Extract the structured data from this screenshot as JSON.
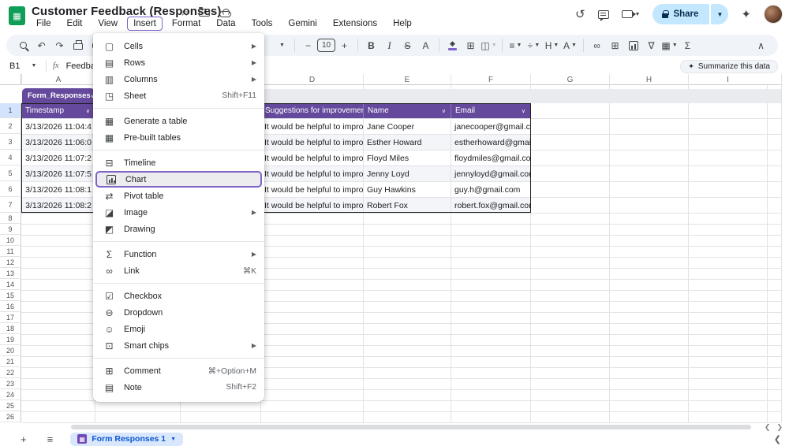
{
  "titlebar": {
    "title": "Customer Feedback (Responses)",
    "icons": [
      "star-icon",
      "move-folder-icon",
      "cloud-status-icon"
    ],
    "right_icons": [
      "history-icon",
      "comments-icon",
      "video-call-icon",
      "gemini-sparkle-icon"
    ],
    "share_label": "Share"
  },
  "menubar": {
    "items": [
      {
        "label": "File"
      },
      {
        "label": "Edit"
      },
      {
        "label": "View"
      },
      {
        "label": "Insert",
        "active": true
      },
      {
        "label": "Format"
      },
      {
        "label": "Data"
      },
      {
        "label": "Tools"
      },
      {
        "label": "Gemini"
      },
      {
        "label": "Extensions"
      },
      {
        "label": "Help"
      }
    ]
  },
  "toolbar": {
    "font_size": "10"
  },
  "formula_bar": {
    "cell_ref": "B1",
    "fx_label": "fx",
    "value": "Feedba"
  },
  "summarize": {
    "label": "Summarize this data",
    "icon_glyph": "✦"
  },
  "insert_menu": {
    "items": [
      {
        "type": "item",
        "icon": "cells-icon",
        "glyph": "▢",
        "label": "Cells",
        "submenu": true
      },
      {
        "type": "item",
        "icon": "rows-icon",
        "glyph": "▤",
        "label": "Rows",
        "submenu": true
      },
      {
        "type": "item",
        "icon": "columns-icon",
        "glyph": "▥",
        "label": "Columns",
        "submenu": true
      },
      {
        "type": "item",
        "icon": "sheet-icon",
        "glyph": "◳",
        "label": "Sheet",
        "shortcut": "Shift+F11"
      },
      {
        "type": "divider"
      },
      {
        "type": "item",
        "icon": "generate-table-icon",
        "glyph": "▦",
        "label": "Generate a table"
      },
      {
        "type": "item",
        "icon": "pre-built-tables-icon",
        "glyph": "▦",
        "label": "Pre-built tables"
      },
      {
        "type": "divider"
      },
      {
        "type": "item",
        "icon": "timeline-icon",
        "glyph": "⊟",
        "label": "Timeline"
      },
      {
        "type": "item",
        "icon": "chart-icon",
        "glyph": "",
        "css_icon": true,
        "label": "Chart",
        "highlighted": true
      },
      {
        "type": "item",
        "icon": "pivot-table-icon",
        "glyph": "⇄",
        "label": "Pivot table"
      },
      {
        "type": "item",
        "icon": "image-icon",
        "glyph": "◪",
        "label": "Image",
        "submenu": true
      },
      {
        "type": "item",
        "icon": "drawing-icon",
        "glyph": "◩",
        "label": "Drawing"
      },
      {
        "type": "divider"
      },
      {
        "type": "item",
        "icon": "function-icon",
        "glyph": "Σ",
        "label": "Function",
        "submenu": true
      },
      {
        "type": "item",
        "icon": "link-icon",
        "glyph": "∞",
        "label": "Link",
        "shortcut": "⌘K"
      },
      {
        "type": "divider"
      },
      {
        "type": "item",
        "icon": "checkbox-icon",
        "glyph": "☑",
        "label": "Checkbox"
      },
      {
        "type": "item",
        "icon": "dropdown-icon",
        "glyph": "⊖",
        "label": "Dropdown"
      },
      {
        "type": "item",
        "icon": "emoji-icon",
        "glyph": "☺",
        "label": "Emoji"
      },
      {
        "type": "item",
        "icon": "smart-chips-icon",
        "glyph": "⊡",
        "label": "Smart chips",
        "submenu": true
      },
      {
        "type": "divider"
      },
      {
        "type": "item",
        "icon": "comment-icon",
        "glyph": "⊞",
        "label": "Comment",
        "shortcut": "⌘+Option+M"
      },
      {
        "type": "item",
        "icon": "note-icon",
        "glyph": "▤",
        "label": "Note",
        "shortcut": "Shift+F2"
      }
    ]
  },
  "grid": {
    "column_letters": [
      "A",
      "B",
      "C",
      "D",
      "E",
      "F",
      "G",
      "H",
      "I"
    ],
    "row_numbers": [
      1,
      2,
      3,
      4,
      5,
      6,
      7,
      8,
      9,
      10,
      11,
      12,
      13,
      14,
      15,
      16,
      17,
      18,
      19,
      20,
      21,
      22,
      23,
      24,
      25,
      26
    ],
    "selected_row": 1
  },
  "table": {
    "name": "Form_Responses",
    "headers": [
      {
        "col": "A",
        "label": "Timestamp"
      },
      {
        "col": "D",
        "label": "Suggestions for improvement"
      },
      {
        "col": "E",
        "label": "Name"
      },
      {
        "col": "F",
        "label": "Email"
      }
    ],
    "rows": [
      {
        "timestamp": "3/13/2026 11:04:4",
        "suggestion": "It would be helpful to improve page",
        "name": "Jane Cooper",
        "email": "janecooper@gmail.com"
      },
      {
        "timestamp": "3/13/2026 11:06:0",
        "suggestion": "It would be helpful to improve page",
        "name": "Esther Howard",
        "email": "estherhoward@gmail.co"
      },
      {
        "timestamp": "3/13/2026 11:07:2",
        "suggestion": "It would be helpful to improve page",
        "name": "Floyd Miles",
        "email": "floydmiles@gmail.com"
      },
      {
        "timestamp": "3/13/2026 11:07:5",
        "suggestion": "It would be helpful to improve page",
        "name": "Jenny Loyd",
        "email": "jennyloyd@gmail.com"
      },
      {
        "timestamp": "3/13/2026 11:08:1",
        "suggestion": "It would be helpful to improve page",
        "name": "Guy Hawkins",
        "email": "guy.h@gmail.com"
      },
      {
        "timestamp": "3/13/2026 11:08:2",
        "suggestion": "It would be helpful to improve page",
        "name": "Robert Fox",
        "email": "robert.fox@gmail.com"
      }
    ]
  },
  "bottombar": {
    "sheet_tab": {
      "label": "Form Responses 1"
    }
  },
  "colors": {
    "table_purple": "#65499c",
    "highlight_purple": "#7e64c8",
    "share_bg": "#c2e7ff",
    "tab_bg": "#d9e7fd",
    "link_blue": "#0b57d0",
    "band_gray": "#e9ebee",
    "row_alt": "#f4f5f8",
    "sheets_green": "#0f9d58"
  }
}
